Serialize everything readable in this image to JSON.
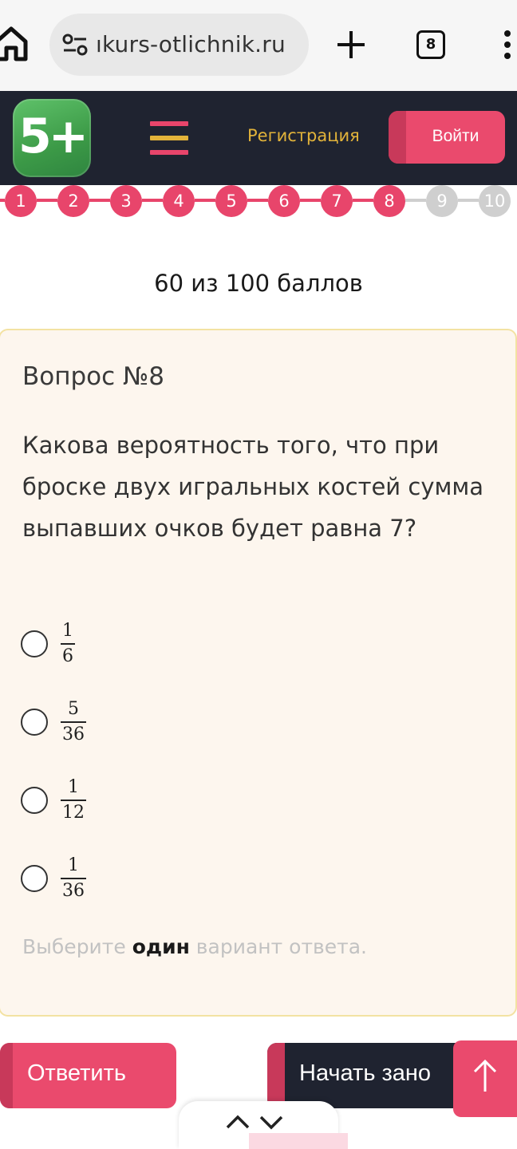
{
  "browser": {
    "url": "ıkurs-otlichnik.ru",
    "tab_count": "8"
  },
  "header": {
    "logo_text": "5+",
    "register_label": "Регистрация",
    "login_label": "Войти",
    "colors": {
      "header_bg": "#1f2330",
      "accent": "#ea4a6d",
      "link": "#e2b33a",
      "logo": "#3c9a47"
    }
  },
  "progress": {
    "steps": [
      "1",
      "2",
      "3",
      "4",
      "5",
      "6",
      "7",
      "8",
      "9",
      "10"
    ],
    "current": 8
  },
  "score": "60 из 100 баллов",
  "question": {
    "number_label": "Вопрос №8",
    "text": "Какова вероятность того, что при броске двух игральных костей сумма выпавших очков будет равна 7?",
    "options": [
      {
        "num": "1",
        "den": "6"
      },
      {
        "num": "5",
        "den": "36"
      },
      {
        "num": "1",
        "den": "12"
      },
      {
        "num": "1",
        "den": "36"
      }
    ],
    "hint_before": "Выберите ",
    "hint_bold": "один",
    "hint_after": " вариант ответа."
  },
  "buttons": {
    "answer_label": "Ответить",
    "restart_label": "Начать зано"
  },
  "icons": [
    "home-icon",
    "tune-icon",
    "plus-icon",
    "tabs-icon",
    "more-vert-icon",
    "burger-menu-icon",
    "arrow-up-icon",
    "chevron-up-icon",
    "chevron-down-icon"
  ]
}
